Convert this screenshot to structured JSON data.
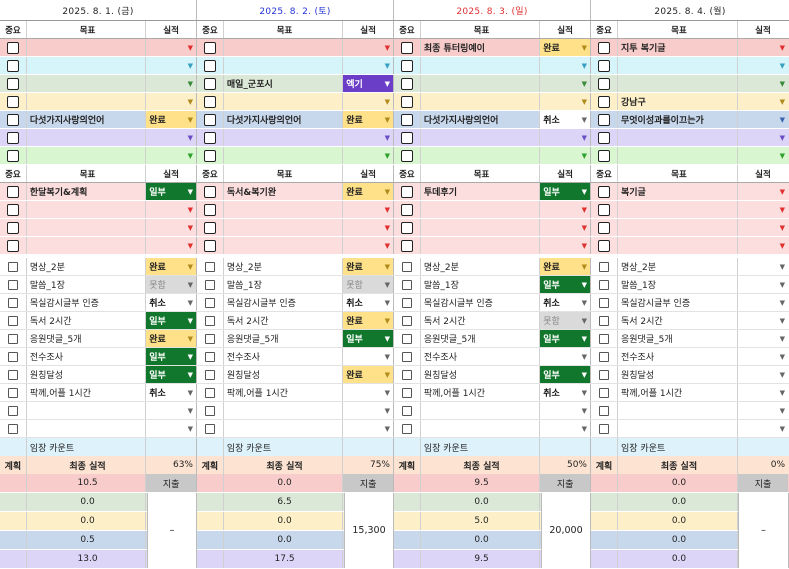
{
  "dates": [
    {
      "text": "2025. 8. 1. (금)",
      "color": "#222222"
    },
    {
      "text": "2025. 8. 2. (토)",
      "color": "#2434d6"
    },
    {
      "text": "2025. 8. 3. (일)",
      "color": "#e03131"
    },
    {
      "text": "2025. 8. 4. (월)",
      "color": "#222222"
    }
  ],
  "headers": {
    "imp": "중요",
    "goal": "목표",
    "result": "실적"
  },
  "dropdown_arrow": "▼",
  "status_labels": {
    "done": "완료",
    "partial": "일부",
    "cancel": "취소",
    "none": "못함",
    "extra": "엑기"
  },
  "top_section": {
    "row_colors": [
      "#f9cccc",
      "#d5f5fa",
      "#dbe8d7",
      "#fdf0c9",
      "#c8d8ec",
      "#ddd5f7",
      "#d8f6cf"
    ],
    "arrow_colors": [
      "#e03131",
      "#3aa0c0",
      "#3a8a3a",
      "#b08a1a",
      "#3a66b0",
      "#6a4ec6",
      "#2ea02e"
    ],
    "days": [
      [
        [
          "",
          ""
        ],
        [
          "",
          ""
        ],
        [
          "",
          ""
        ],
        [
          "",
          ""
        ],
        [
          "다섯가지사랑의언어",
          "done"
        ],
        [
          "",
          ""
        ],
        [
          "",
          ""
        ]
      ],
      [
        [
          "",
          ""
        ],
        [
          "",
          ""
        ],
        [
          "매일_군포시",
          "extra"
        ],
        [
          "",
          ""
        ],
        [
          "다섯가지사랑의언어",
          "done"
        ],
        [
          "",
          ""
        ],
        [
          "",
          ""
        ]
      ],
      [
        [
          "최종 튜터링예이",
          "done"
        ],
        [
          "",
          ""
        ],
        [
          "",
          ""
        ],
        [
          "",
          ""
        ],
        [
          "다섯가지사랑의언어",
          "cancel"
        ],
        [
          "",
          ""
        ],
        [
          "",
          ""
        ]
      ],
      [
        [
          "지투 복기글",
          ""
        ],
        [
          "",
          ""
        ],
        [
          "",
          ""
        ],
        [
          "강남구",
          ""
        ],
        [
          "무엇이성과를이끄는가",
          ""
        ],
        [
          "",
          ""
        ],
        [
          "",
          ""
        ]
      ]
    ]
  },
  "mid_section": {
    "row_color": "#fddede",
    "days": [
      [
        [
          "한달복기&계획",
          "partial"
        ],
        [
          "",
          ""
        ],
        [
          "",
          ""
        ],
        [
          "",
          ""
        ]
      ],
      [
        [
          "독서&복기완",
          "done"
        ],
        [
          "",
          ""
        ],
        [
          "",
          ""
        ],
        [
          "",
          ""
        ]
      ],
      [
        [
          "투데후기",
          "partial"
        ],
        [
          "",
          ""
        ],
        [
          "",
          ""
        ],
        [
          "",
          ""
        ]
      ],
      [
        [
          "복기글",
          ""
        ],
        [
          "",
          ""
        ],
        [
          "",
          ""
        ],
        [
          "",
          ""
        ]
      ]
    ]
  },
  "habit_section": {
    "days": [
      [
        [
          "명상_2분",
          "done"
        ],
        [
          "말씀_1장",
          "none"
        ],
        [
          "목실감시글부 인증",
          "cancel"
        ],
        [
          "독서 2시간",
          "partial"
        ],
        [
          "응원댓글_5개",
          "done"
        ],
        [
          "전수조사",
          "partial"
        ],
        [
          "원칭달성",
          "partial"
        ],
        [
          "팍께,어플 1시간",
          "cancel"
        ],
        [
          "",
          ""
        ],
        [
          "",
          ""
        ]
      ],
      [
        [
          "명상_2분",
          "done"
        ],
        [
          "말씀_1장",
          "none"
        ],
        [
          "목실감시글부 인증",
          "cancel"
        ],
        [
          "독서 2시간",
          "done"
        ],
        [
          "응원댓글_5개",
          "partial"
        ],
        [
          "전수조사",
          ""
        ],
        [
          "원칭달성",
          "done"
        ],
        [
          "팍께,어플 1시간",
          ""
        ],
        [
          "",
          ""
        ],
        [
          "",
          ""
        ]
      ],
      [
        [
          "명상_2분",
          "done"
        ],
        [
          "말씀_1장",
          "partial"
        ],
        [
          "목실감시글부 인증",
          "cancel"
        ],
        [
          "독서 2시간",
          "none"
        ],
        [
          "응원댓글_5개",
          "partial"
        ],
        [
          "전수조사",
          ""
        ],
        [
          "원칭달성",
          "partial"
        ],
        [
          "팍께,어플 1시간",
          "cancel"
        ],
        [
          "",
          ""
        ],
        [
          "",
          ""
        ]
      ],
      [
        [
          "명상_2분",
          ""
        ],
        [
          "말씀_1장",
          ""
        ],
        [
          "목실감시글부 인증",
          ""
        ],
        [
          "독서 2시간",
          ""
        ],
        [
          "응원댓글_5개",
          ""
        ],
        [
          "전수조사",
          ""
        ],
        [
          "원칭달성",
          ""
        ],
        [
          "팍께,어플 1시간",
          ""
        ],
        [
          "",
          ""
        ],
        [
          "",
          ""
        ]
      ]
    ]
  },
  "count_label": "임장 카운트",
  "summary": {
    "col_plan": "계획",
    "col_final": "최종 실적",
    "expense_label": "지출",
    "row_colors": [
      "#f9cccc",
      "#dbe8d7",
      "#fdf0c9",
      "#c8d8ec",
      "#ddd5f7"
    ],
    "days": [
      {
        "pct": "63%",
        "values": [
          "10.5",
          "0.0",
          "0.0",
          "0.5",
          "13.0"
        ],
        "total": "–"
      },
      {
        "pct": "75%",
        "values": [
          "0.0",
          "6.5",
          "0.0",
          "0.0",
          "17.5"
        ],
        "total": "15,300"
      },
      {
        "pct": "50%",
        "values": [
          "9.5",
          "0.0",
          "5.0",
          "0.0",
          "9.5"
        ],
        "total": "20,000"
      },
      {
        "pct": "0%",
        "values": [
          "0.0",
          "0.0",
          "0.0",
          "0.0",
          "0.0"
        ],
        "total": "–"
      }
    ]
  }
}
